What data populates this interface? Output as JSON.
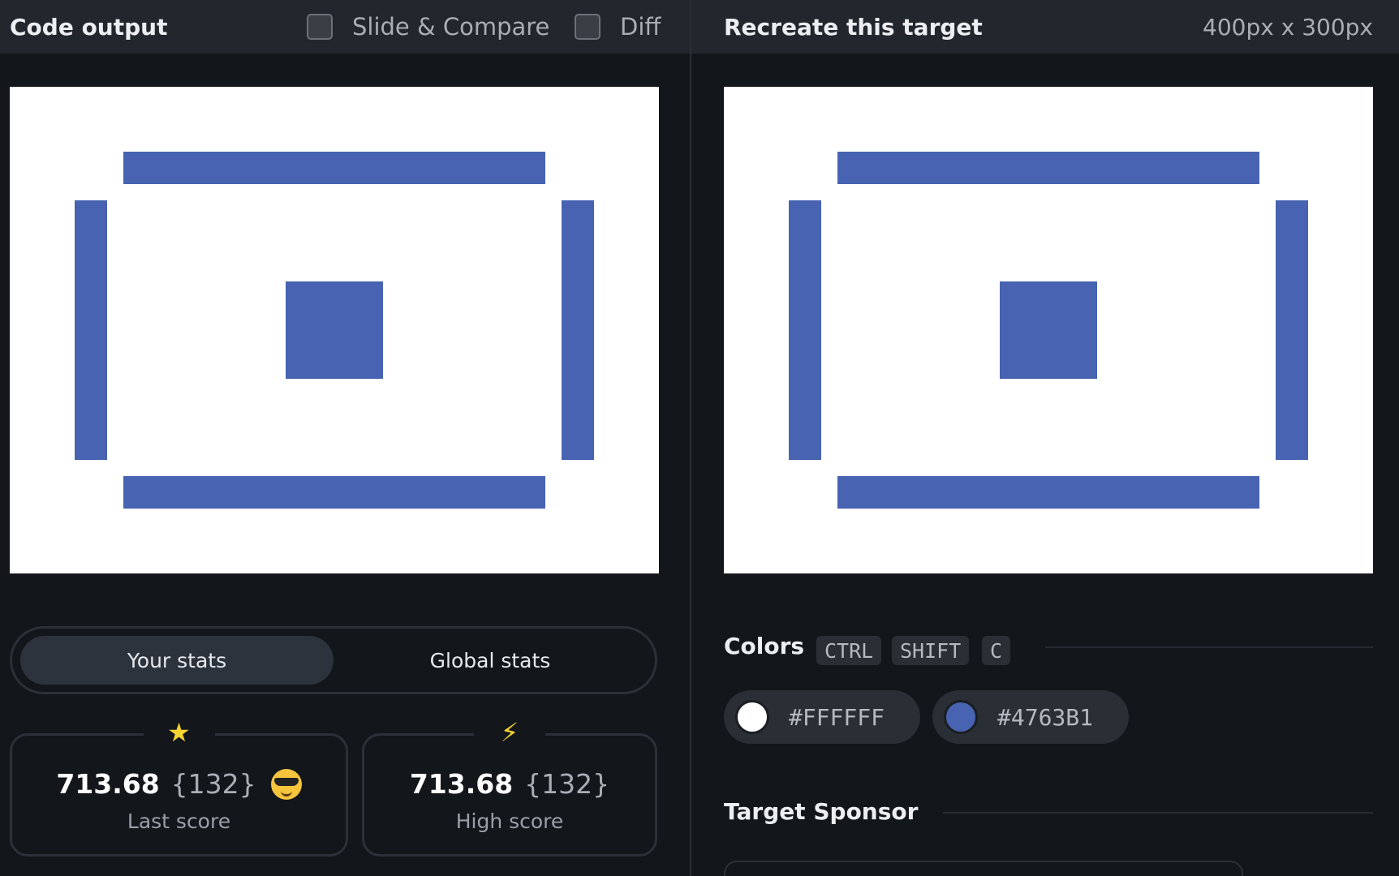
{
  "left_panel": {
    "title": "Code output",
    "toggles": [
      {
        "label": "Slide & Compare",
        "checked": false
      },
      {
        "label": "Diff",
        "checked": false
      }
    ]
  },
  "right_panel": {
    "title": "Recreate this target",
    "dimensions": "400px x 300px"
  },
  "shape_color": "#4763B1",
  "canvas_background": "#FFFFFF",
  "stats": {
    "tabs": [
      {
        "label": "Your stats",
        "active": true
      },
      {
        "label": "Global stats",
        "active": false
      }
    ],
    "last": {
      "icon": "star-icon",
      "glyph": "★",
      "value": "713.68",
      "count": "{132}",
      "label": "Last score"
    },
    "high": {
      "icon": "lightning-icon",
      "glyph": "⚡",
      "value": "713.68",
      "count": "{132}",
      "label": "High score"
    }
  },
  "colors": {
    "title": "Colors",
    "shortcut": [
      "CTRL",
      "SHIFT",
      "C"
    ],
    "swatches": [
      {
        "hex": "#FFFFFF"
      },
      {
        "hex": "#4763B1"
      }
    ]
  },
  "sponsor": {
    "title": "Target Sponsor"
  }
}
